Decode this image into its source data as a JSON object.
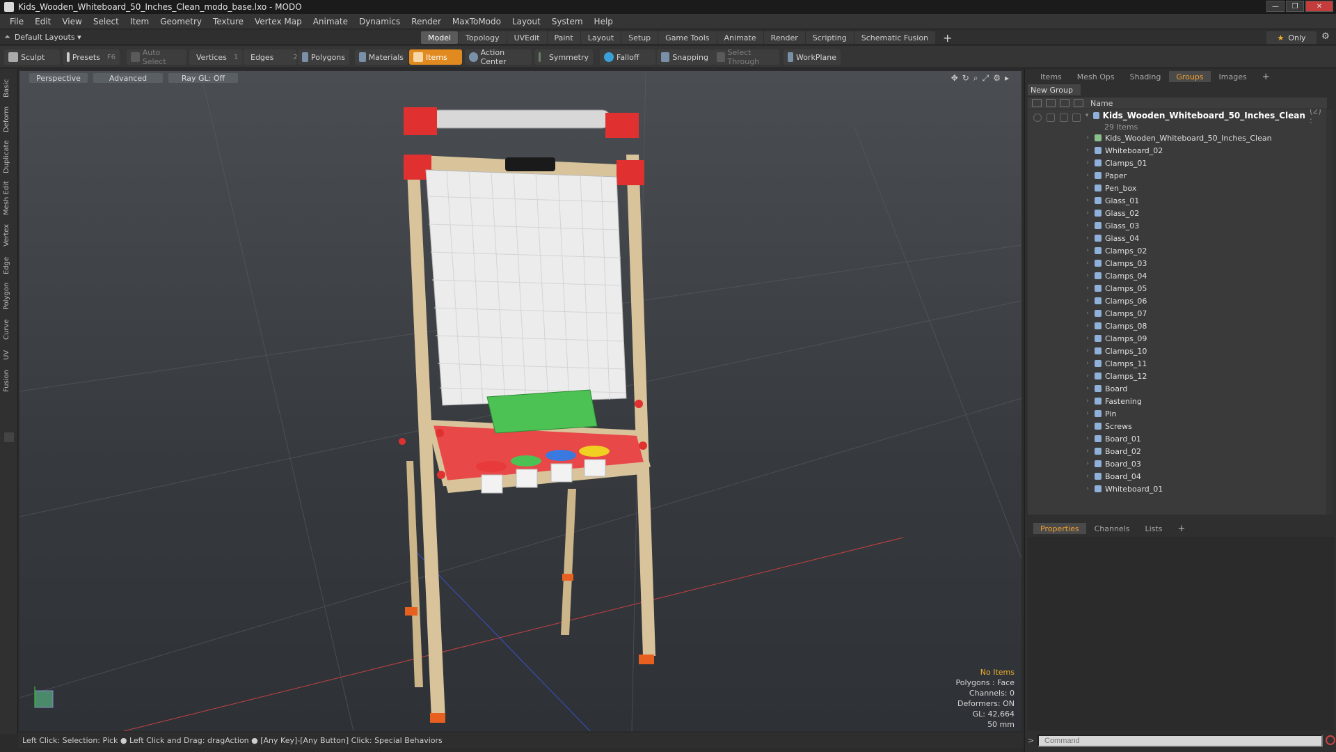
{
  "window": {
    "title": "Kids_Wooden_Whiteboard_50_Inches_Clean_modo_base.lxo - MODO",
    "min": "—",
    "max": "❐",
    "close": "✕"
  },
  "menu": [
    "File",
    "Edit",
    "View",
    "Select",
    "Item",
    "Geometry",
    "Texture",
    "Vertex Map",
    "Animate",
    "Dynamics",
    "Render",
    "MaxToModo",
    "Layout",
    "System",
    "Help"
  ],
  "layout_dropdown": "Default Layouts ▾",
  "mode_tabs": [
    "Model",
    "Topology",
    "UVEdit",
    "Paint",
    "Layout",
    "Setup",
    "Game Tools",
    "Animate",
    "Render",
    "Scripting",
    "Schematic Fusion"
  ],
  "mode_active": "Model",
  "only_label": "Only",
  "toolbar": {
    "sculpt": "Sculpt",
    "presets": "Presets",
    "presets_key": "F6",
    "auto_select": "Auto Select",
    "vertices": "Vertices",
    "vertices_key": "1",
    "edges": "Edges",
    "edges_key": "2",
    "polygons": "Polygons",
    "materials": "Materials",
    "items": "Items",
    "action_center": "Action Center",
    "symmetry": "Symmetry",
    "falloff": "Falloff",
    "snapping": "Snapping",
    "select_through": "Select Through",
    "workplane": "WorkPlane"
  },
  "left_tabs": [
    "Basic",
    "Deform",
    "Duplicate",
    "Mesh Edit",
    "Vertex",
    "Edge",
    "Polygon",
    "Curve",
    "UV",
    "Fusion"
  ],
  "viewport": {
    "view": "Perspective",
    "shading": "Advanced",
    "raygl": "Ray GL: Off",
    "stats": {
      "selection": "No Items",
      "polygons": "Polygons : Face",
      "channels": "Channels: 0",
      "deformers": "Deformers: ON",
      "gl": "GL: 42,664",
      "unit": "50 mm"
    }
  },
  "status_bar": "Left Click: Selection: Pick ● Left Click and Drag: dragAction ● [Any Key]-[Any Button] Click: Special Behaviors",
  "right_panel": {
    "tabs": [
      "Items",
      "Mesh Ops",
      "Shading",
      "Groups",
      "Images"
    ],
    "active_tab": "Groups",
    "new_group": "New Group",
    "column_name": "Name",
    "group": {
      "name": "Kids_Wooden_Whiteboard_50_Inches_Clean",
      "count": "(2) :",
      "items_label": "29 Items"
    },
    "items": [
      "Kids_Wooden_Whiteboard_50_Inches_Clean",
      "Whiteboard_02",
      "Clamps_01",
      "Paper",
      "Pen_box",
      "Glass_01",
      "Glass_02",
      "Glass_03",
      "Glass_04",
      "Clamps_02",
      "Clamps_03",
      "Clamps_04",
      "Clamps_05",
      "Clamps_06",
      "Clamps_07",
      "Clamps_08",
      "Clamps_09",
      "Clamps_10",
      "Clamps_11",
      "Clamps_12",
      "Board",
      "Fastening",
      "Pin",
      "Screws",
      "Board_01",
      "Board_02",
      "Board_03",
      "Board_04",
      "Whiteboard_01"
    ],
    "props_tabs": [
      "Properties",
      "Channels",
      "Lists"
    ],
    "props_active": "Properties",
    "command_placeholder": "Command"
  },
  "colors": {
    "accent": "#e08a20",
    "wood": "#d9c39b",
    "red": "#e83a3a",
    "green": "#4cc255",
    "blue": "#3a7ae0",
    "yellow": "#f0d020"
  }
}
